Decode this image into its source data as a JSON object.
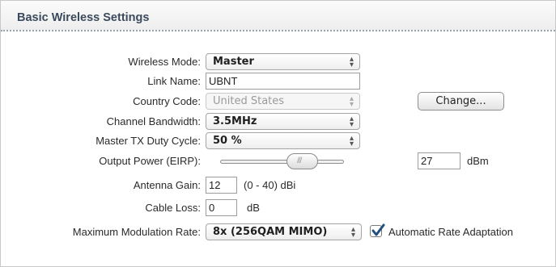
{
  "panel": {
    "title": "Basic Wireless Settings"
  },
  "wireless_mode": {
    "label": "Wireless Mode:",
    "value": "Master"
  },
  "link_name": {
    "label": "Link Name:",
    "value": "UBNT"
  },
  "country_code": {
    "label": "Country Code:",
    "value": "United States",
    "button": "Change..."
  },
  "channel_bandwidth": {
    "label": "Channel Bandwidth:",
    "value": "3.5MHz"
  },
  "duty_cycle": {
    "label": "Master TX Duty Cycle:",
    "value": "50 %"
  },
  "output_power": {
    "label": "Output Power (EIRP):",
    "value": "27",
    "unit": "dBm"
  },
  "antenna_gain": {
    "label": "Antenna Gain:",
    "value": "12",
    "hint": "(0 - 40) dBi"
  },
  "cable_loss": {
    "label": "Cable Loss:",
    "value": "0",
    "unit": "dB"
  },
  "modulation": {
    "label": "Maximum Modulation Rate:",
    "value": "8x (256QAM MIMO)",
    "auto_rate_label": "Automatic Rate Adaptation",
    "auto_rate_checked": true
  },
  "icons": {
    "select_arrows": "updown-arrows-icon",
    "checkmark": "checkmark-icon",
    "slider_grip": "grip-icon"
  },
  "colors": {
    "title": "#3b4a5c",
    "checkmark": "#24507f"
  }
}
